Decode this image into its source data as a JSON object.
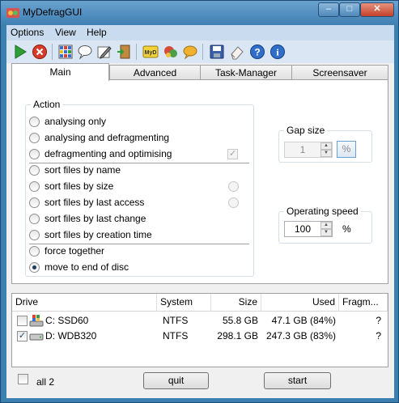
{
  "window": {
    "title": "MyDefragGUI",
    "controls": {
      "minimize": "–",
      "maximize": "□",
      "close": "✕"
    }
  },
  "menu": [
    "Options",
    "View",
    "Help"
  ],
  "toolbar": {
    "icons": [
      "play-icon",
      "stop-icon",
      "grid-icon",
      "speech-bubble-icon",
      "edit-icon",
      "exit-door-icon",
      "mydefrag-logo-icon",
      "paint-icon",
      "chat-bubble-icon",
      "save-icon",
      "eraser-icon",
      "help-icon",
      "info-icon"
    ],
    "mydefrag_text": "MyD"
  },
  "tabs": [
    "Main",
    "Advanced",
    "Task-Manager",
    "Screensaver"
  ],
  "action": {
    "legend": "Action",
    "options": [
      "analysing only",
      "analysing and defragmenting",
      "defragmenting and optimising",
      "sort files by name",
      "sort files by size",
      "sort files by last access",
      "sort files by last change",
      "sort files by creation time",
      "force together",
      "move to end of disc"
    ],
    "selected": "move to end of disc"
  },
  "gap": {
    "legend": "Gap size",
    "value": "1",
    "unit": "%"
  },
  "speed": {
    "legend": "Operating speed",
    "value": "100",
    "unit": "%"
  },
  "drives": {
    "columns": [
      "Drive",
      "System",
      "Size",
      "Used",
      "Fragm..."
    ],
    "rows": [
      {
        "checked": false,
        "drive": "C: SSD60",
        "system": "NTFS",
        "size": "55.8 GB",
        "used": "47.1 GB (84%)",
        "fragm": "?"
      },
      {
        "checked": true,
        "drive": "D: WDB320",
        "system": "NTFS",
        "size": "298.1 GB",
        "used": "247.3 GB (83%)",
        "fragm": "?"
      }
    ]
  },
  "footer": {
    "all_label": "all 2",
    "quit": "quit",
    "start": "start"
  }
}
